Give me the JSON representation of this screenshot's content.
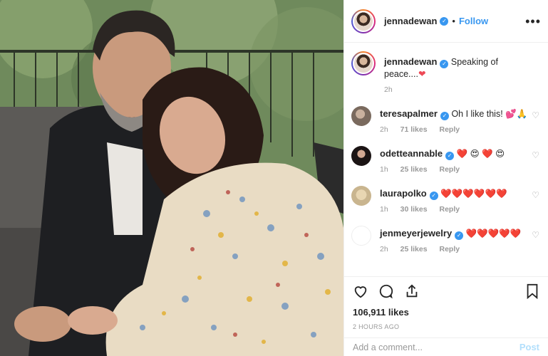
{
  "post": {
    "username": "jennadewan",
    "follow_label": "Follow",
    "separator": "•",
    "more_label": "•••"
  },
  "caption": {
    "username": "jennadewan",
    "text": "Speaking of peace....",
    "emoji": "❤",
    "time": "2h"
  },
  "comments": [
    {
      "username": "teresapalmer",
      "text": "Oh I like this! 💕🙏",
      "time": "2h",
      "likes": "71 likes",
      "reply": "Reply"
    },
    {
      "username": "odetteannable",
      "text": "❤️ 😍 ❤️ 😍",
      "time": "1h",
      "likes": "25 likes",
      "reply": "Reply"
    },
    {
      "username": "laurapolko",
      "text": "❤️❤️❤️❤️❤️❤️",
      "time": "1h",
      "likes": "30 likes",
      "reply": "Reply"
    },
    {
      "username": "jenmeyerjewelry",
      "text": "❤️❤️❤️❤️❤️",
      "time": "2h",
      "likes": "25 likes",
      "reply": "Reply"
    }
  ],
  "engagement": {
    "likes": "106,911 likes",
    "timestamp": "2 HOURS AGO"
  },
  "add_comment": {
    "placeholder": "Add a comment...",
    "post_label": "Post"
  },
  "icons": {
    "verified": "verified-badge-icon",
    "like": "heart-outline-icon",
    "comment": "comment-bubble-icon",
    "share": "share-icon",
    "save": "bookmark-icon"
  },
  "colors": {
    "link": "#3897f0",
    "heart": "#ed4956",
    "muted": "#999999"
  }
}
